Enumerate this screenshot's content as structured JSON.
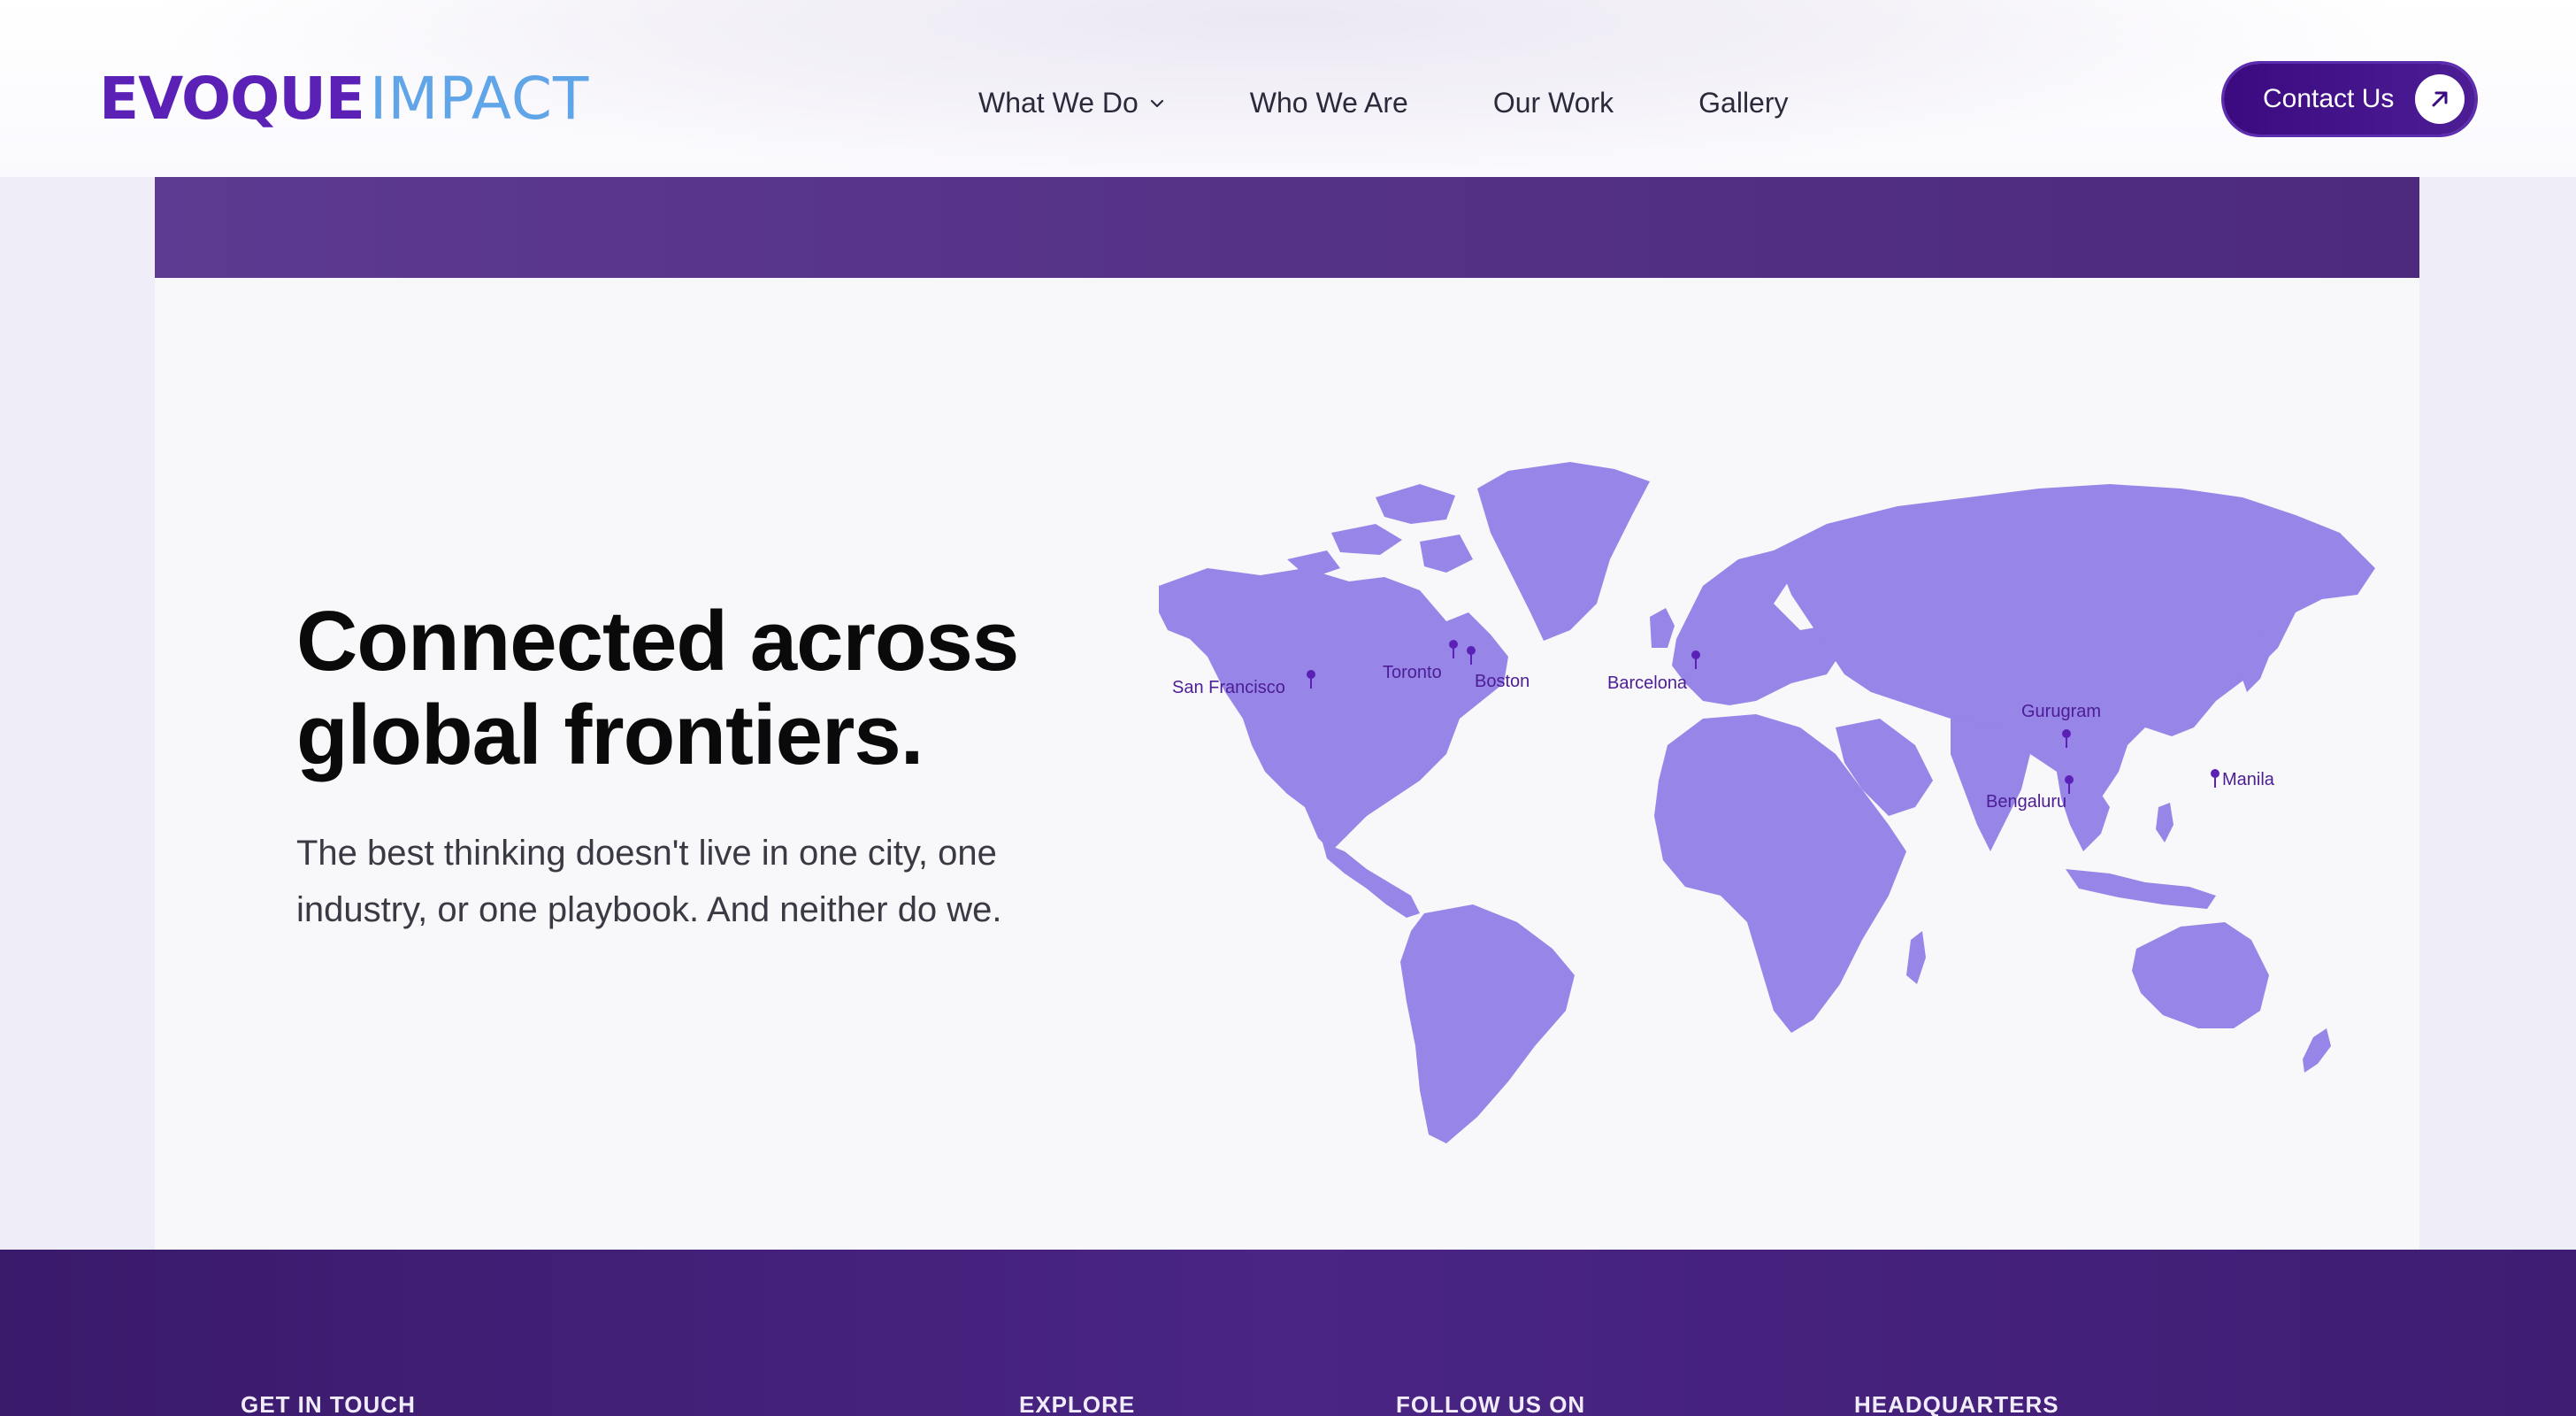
{
  "header": {
    "logo_part1": "EVOQUE",
    "logo_part2": "IMPACT",
    "nav": [
      {
        "label": "What We Do",
        "has_dropdown": true
      },
      {
        "label": "Who We Are"
      },
      {
        "label": "Our Work"
      },
      {
        "label": "Gallery"
      }
    ],
    "contact_label": "Contact Us"
  },
  "hero": {
    "headline_line1": "Connected across",
    "headline_line2": "global frontiers.",
    "subtext_line1": "The best thinking doesn't live in one city, one",
    "subtext_line2": "industry, or one playbook. And neither do we."
  },
  "map": {
    "land_color": "#9785e8",
    "pin_color": "#5b21b6",
    "cities": [
      {
        "name": "San Francisco"
      },
      {
        "name": "Toronto"
      },
      {
        "name": "Boston"
      },
      {
        "name": "Barcelona"
      },
      {
        "name": "Gurugram"
      },
      {
        "name": "Bengaluru"
      },
      {
        "name": "Manila"
      }
    ]
  },
  "footer": {
    "headings": [
      "GET IN TOUCH",
      "EXPLORE",
      "FOLLOW US ON",
      "HEADQUARTERS"
    ]
  },
  "colors": {
    "brand_purple": "#5b21b6",
    "brand_blue": "#60a5e8",
    "footer_purple": "#3a1a6b"
  }
}
